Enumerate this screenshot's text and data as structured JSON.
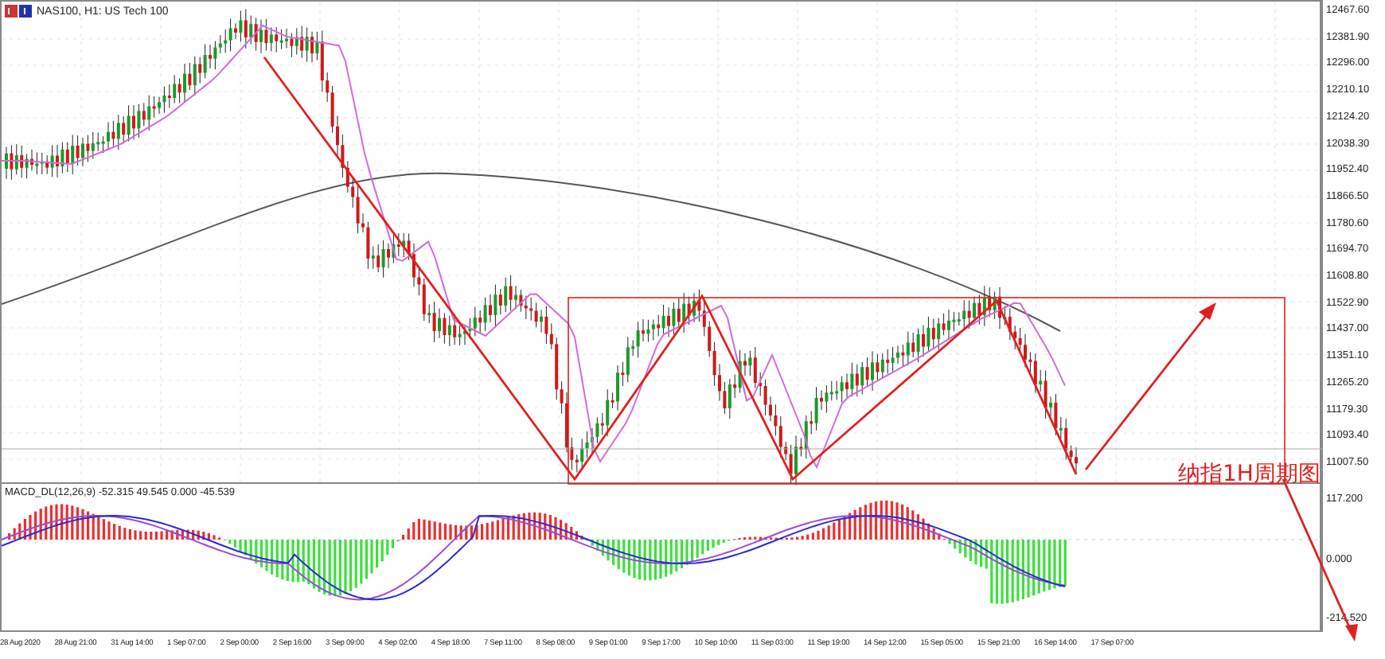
{
  "chart_header": {
    "title": "NAS100, H1:  US Tech 100"
  },
  "price_axis": {
    "labels": [
      "12467.60",
      "12381.90",
      "12296.00",
      "12210.10",
      "12124.20",
      "12038.30",
      "11952.40",
      "11866.50",
      "11780.60",
      "11694.70",
      "11608.80",
      "11522.90",
      "11437.00",
      "11351.10",
      "11265.20",
      "11179.30",
      "11093.40",
      "11007.50"
    ]
  },
  "annotation": {
    "label": "纳指1H周期图"
  },
  "macd_panel": {
    "title": "MACD_DL(12,26,9) -52.315  49.545 0.000 -45.539",
    "axis_labels": [
      "117.200",
      "0.000",
      "-214.520"
    ]
  },
  "time_axis": {
    "labels": [
      "28 Aug 2020",
      "28 Aug 21:00",
      "31 Aug 14:00",
      "1 Sep 07:00",
      "2 Sep 00:00",
      "2 Sep 16:00",
      "3 Sep 09:00",
      "4 Sep 02:00",
      "4 Sep 18:00",
      "7 Sep 11:00",
      "8 Sep 08:00",
      "9 Sep 01:00",
      "9 Sep 17:00",
      "10 Sep 10:00",
      "11 Sep 03:00",
      "11 Sep 19:00",
      "14 Sep 12:00",
      "15 Sep 05:00",
      "15 Sep 21:00",
      "16 Sep 14:00",
      "17 Sep 07:00"
    ]
  }
}
